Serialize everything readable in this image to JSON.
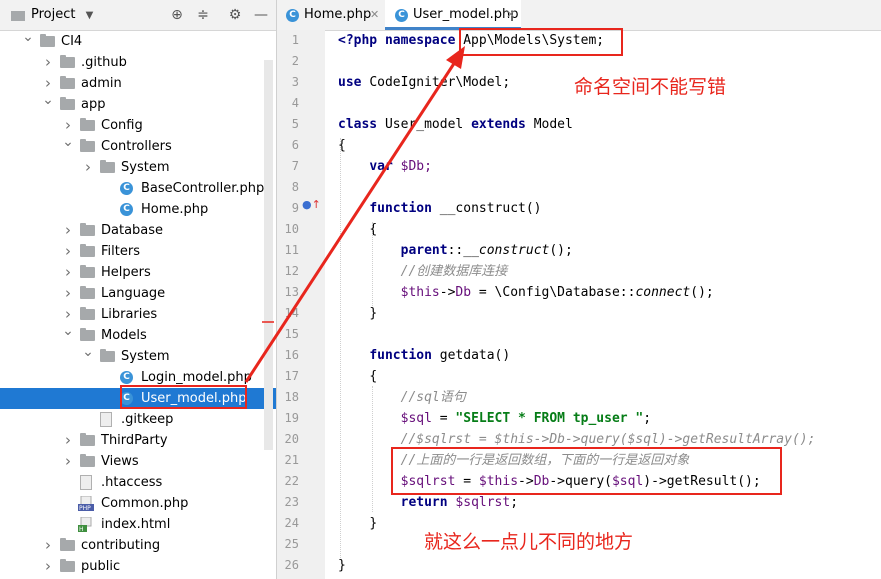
{
  "project_panel": {
    "title": "Project",
    "tree": [
      {
        "label": "CI4",
        "type": "folder",
        "expanded": true
      },
      {
        "label": ".github",
        "type": "folder",
        "expanded": false
      },
      {
        "label": "admin",
        "type": "folder",
        "expanded": false
      },
      {
        "label": "app",
        "type": "folder",
        "expanded": true
      },
      {
        "label": "Config",
        "type": "folder",
        "expanded": false
      },
      {
        "label": "Controllers",
        "type": "folder",
        "expanded": true
      },
      {
        "label": "System",
        "type": "folder",
        "expanded": false
      },
      {
        "label": "BaseController.php",
        "type": "class"
      },
      {
        "label": "Home.php",
        "type": "class"
      },
      {
        "label": "Database",
        "type": "folder",
        "expanded": false
      },
      {
        "label": "Filters",
        "type": "folder",
        "expanded": false
      },
      {
        "label": "Helpers",
        "type": "folder",
        "expanded": false
      },
      {
        "label": "Language",
        "type": "folder",
        "expanded": false
      },
      {
        "label": "Libraries",
        "type": "folder",
        "expanded": false
      },
      {
        "label": "Models",
        "type": "folder",
        "expanded": true
      },
      {
        "label": "System",
        "type": "folder",
        "expanded": true
      },
      {
        "label": "Login_model.php",
        "type": "class"
      },
      {
        "label": "User_model.php",
        "type": "class",
        "selected": true
      },
      {
        "label": ".gitkeep",
        "type": "file"
      },
      {
        "label": "ThirdParty",
        "type": "folder",
        "expanded": false
      },
      {
        "label": "Views",
        "type": "folder",
        "expanded": false
      },
      {
        "label": ".htaccess",
        "type": "file"
      },
      {
        "label": "Common.php",
        "type": "php"
      },
      {
        "label": "index.html",
        "type": "html"
      },
      {
        "label": "contributing",
        "type": "folder",
        "expanded": false
      },
      {
        "label": "public",
        "type": "folder",
        "expanded": false
      }
    ]
  },
  "tabs": [
    {
      "label": "Home.php",
      "active": false
    },
    {
      "label": "User_model.php",
      "active": true
    }
  ],
  "line_numbers": [
    "1",
    "2",
    "3",
    "4",
    "5",
    "6",
    "7",
    "8",
    "9",
    "10",
    "11",
    "12",
    "13",
    "14",
    "15",
    "16",
    "17",
    "18",
    "19",
    "20",
    "21",
    "22",
    "23",
    "24",
    "25",
    "26"
  ],
  "code": {
    "l1_kw": "<?php namespace",
    "l1_ns": "App\\Models\\System;",
    "l3_kw": "use",
    "l3_rest": "CodeIgniter\\Model;",
    "l5_kw1": "class",
    "l5_name": "User_model",
    "l5_kw2": "extends",
    "l5_parent": "Model",
    "l6": "{",
    "l7_kw": "var",
    "l7_var": "$Db;",
    "l9_kw": "function",
    "l9_rest": "__construct()",
    "l10": "{",
    "l11_kw": "parent",
    "l11_sep": "::",
    "l11_call": "__construct",
    "l11_end": "();",
    "l12_comment": "//创建数据库连接",
    "l13_var": "$this",
    "l13_arrow": "->",
    "l13_prop": "Db",
    "l13_mid": " = \\Config\\Database::",
    "l13_call": "connect",
    "l13_end": "();",
    "l14": "}",
    "l16_kw": "function",
    "l16_rest": "getdata()",
    "l17": "{",
    "l18_comment": "//sql语句",
    "l19_var": "$sql",
    "l19_eq": " = ",
    "l19_str": "\"SELECT * FROM tp_user \"",
    "l19_end": ";",
    "l20_comment": "//$sqlrst = $this->Db->query($sql)->getResultArray();",
    "l21_comment": "//上面的一行是返回数组，下面的一行是返回对象",
    "l22_var": "$sqlrst",
    "l22_eq": " = ",
    "l22_this": "$this",
    "l22_arrow": "->",
    "l22_prop": "Db",
    "l22_q1": "->query(",
    "l22_arg": "$sql",
    "l22_q2": ")->getResult();",
    "l23_kw": "return",
    "l23_var": "$sqlrst",
    "l23_end": ";",
    "l24": "}",
    "l26": "}"
  },
  "annotations": {
    "namespace_note": "命名空间不能写错",
    "difference_note": "就这么一点儿不同的地方"
  },
  "colors": {
    "selection": "#1f79d3",
    "annotation_red": "#e8261d",
    "keyword": "#000080",
    "string": "#067d17",
    "comment": "#8c8c8c",
    "variable": "#660e7a"
  }
}
